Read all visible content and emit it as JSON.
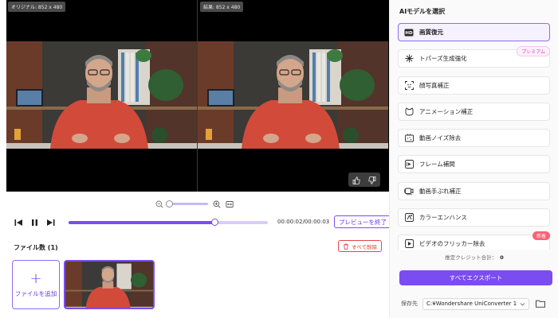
{
  "preview": {
    "original_label": "オリジナル: 852 x 480",
    "result_label": "結果: 852 x 480"
  },
  "playback": {
    "time": "00:00:02/00:00:03",
    "progress": 0.73,
    "end_preview_label": "プレビューを終了"
  },
  "zoom": {
    "level": 0.0
  },
  "files": {
    "title": "ファイル数 (1)",
    "delete_all_label": "すべて削除",
    "add_file_label": "ファイルを追加",
    "add_plus": "+"
  },
  "sidebar": {
    "title": "AIモデルを選択",
    "models": [
      {
        "label": "画質復元",
        "icon": "hd-icon",
        "selected": true
      },
      {
        "label": "トパーズ生成強化",
        "icon": "sparkle-icon",
        "badge": "プレミアム"
      },
      {
        "label": "顔写真補正",
        "icon": "face-icon"
      },
      {
        "label": "アニメーション補正",
        "icon": "anime-icon"
      },
      {
        "label": "動画ノイズ除去",
        "icon": "denoise-icon"
      },
      {
        "label": "フレーム補間",
        "icon": "frame-icon"
      },
      {
        "label": "動画手ぶれ補正",
        "icon": "stabilize-icon"
      },
      {
        "label": "カラーエンハンス",
        "icon": "color-icon"
      },
      {
        "label": "ビデオのフリッカー除去",
        "icon": "flicker-icon",
        "badge": "新着"
      }
    ],
    "credits_label": "推定クレジット合計：",
    "credits_value": "0",
    "export_label": "すべてエクスポート",
    "save_label": "保存先",
    "save_path": "C:¥Wondershare UniConverter 1"
  },
  "colors": {
    "accent": "#7b4cf0",
    "danger": "#e04848",
    "premium": "#d33fb8",
    "new": "#ff5f73"
  }
}
